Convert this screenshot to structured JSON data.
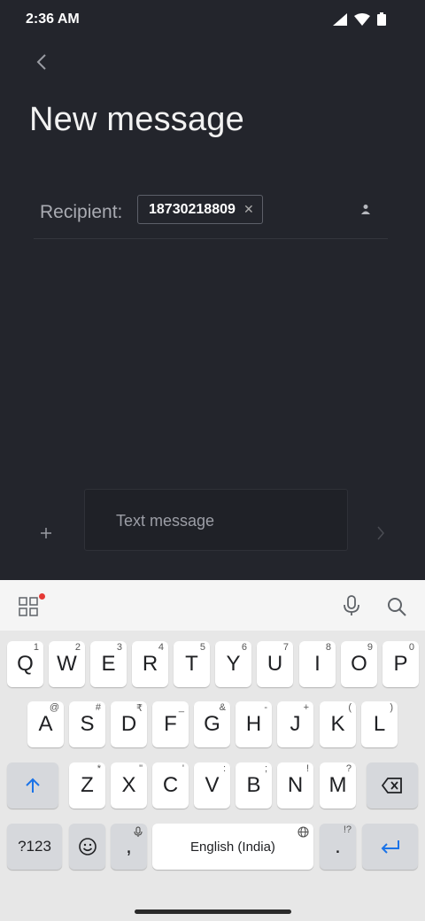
{
  "status_bar": {
    "time": "2:36 AM"
  },
  "header": {
    "title": "New message"
  },
  "recipient": {
    "label": "Recipient:",
    "chip_value": "18730218809"
  },
  "composer": {
    "placeholder": "Text message"
  },
  "keyboard": {
    "row1": [
      {
        "key": "Q",
        "hint": "1"
      },
      {
        "key": "W",
        "hint": "2"
      },
      {
        "key": "E",
        "hint": "3"
      },
      {
        "key": "R",
        "hint": "4"
      },
      {
        "key": "T",
        "hint": "5"
      },
      {
        "key": "Y",
        "hint": "6"
      },
      {
        "key": "U",
        "hint": "7"
      },
      {
        "key": "I",
        "hint": "8"
      },
      {
        "key": "O",
        "hint": "9"
      },
      {
        "key": "P",
        "hint": "0"
      }
    ],
    "row2": [
      {
        "key": "A",
        "hint": "@"
      },
      {
        "key": "S",
        "hint": "#"
      },
      {
        "key": "D",
        "hint": "₹"
      },
      {
        "key": "F",
        "hint": "_"
      },
      {
        "key": "G",
        "hint": "&"
      },
      {
        "key": "H",
        "hint": "-"
      },
      {
        "key": "J",
        "hint": "+"
      },
      {
        "key": "K",
        "hint": "("
      },
      {
        "key": "L",
        "hint": ")"
      }
    ],
    "row3": [
      {
        "key": "Z",
        "hint": "*"
      },
      {
        "key": "X",
        "hint": "\""
      },
      {
        "key": "C",
        "hint": "'"
      },
      {
        "key": "V",
        "hint": ":"
      },
      {
        "key": "B",
        "hint": ";"
      },
      {
        "key": "N",
        "hint": "!"
      },
      {
        "key": "M",
        "hint": "?"
      }
    ],
    "symbols_label": "?123",
    "comma_label": ",",
    "space_label": "English (India)",
    "period_label": ".",
    "period_hint": "!?"
  },
  "icons": {
    "back": "chevron-left-icon",
    "contact": "person-icon",
    "add": "plus-icon",
    "send": "chevron-right-icon",
    "apps": "grid-icon",
    "mic": "mic-icon",
    "search": "search-icon",
    "shift": "shift-arrow-icon",
    "backspace": "backspace-icon",
    "emoji": "emoji-icon",
    "enter": "enter-icon"
  },
  "colors": {
    "background": "#23252c",
    "keyboard": "#e7e7e7",
    "accent": "#1a73e8"
  }
}
